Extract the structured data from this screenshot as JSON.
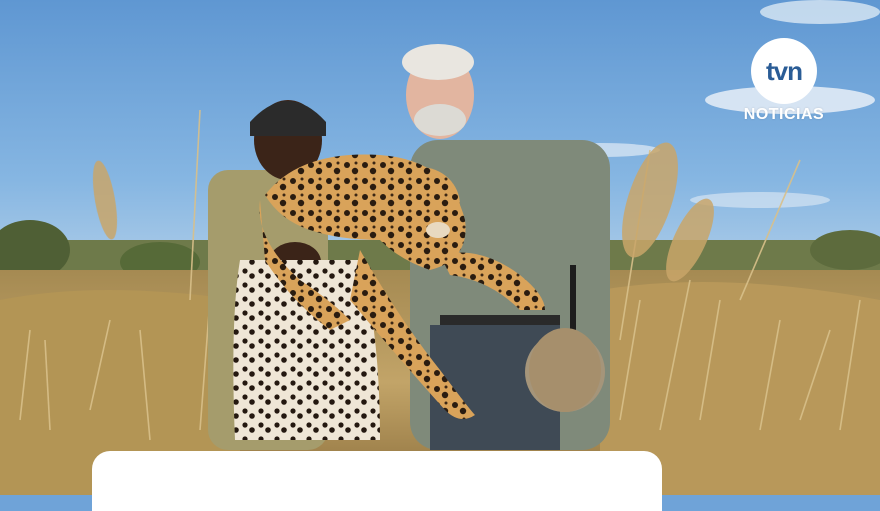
{
  "brand": {
    "logo_top": "tvn",
    "logo_bottom": "NOTICIAS"
  },
  "colors": {
    "sky": "#6fa3d8",
    "grass": "#b89a5a",
    "logo_blue": "#2a5c96"
  }
}
